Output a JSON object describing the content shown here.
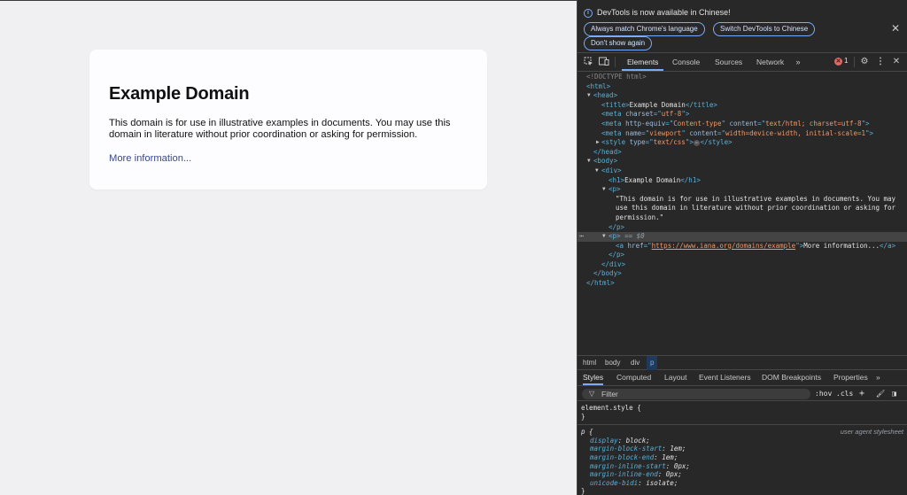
{
  "page": {
    "heading": "Example Domain",
    "body": "This domain is for use in illustrative examples in documents. You may use this domain in literature without prior coordination or asking for permission.",
    "link": "More information..."
  },
  "devtools": {
    "infobar": {
      "message": "DevTools is now available in Chinese!",
      "buttons": [
        "Always match Chrome's language",
        "Switch DevTools to Chinese",
        "Don't show again"
      ]
    },
    "tabs": [
      "Elements",
      "Console",
      "Sources",
      "Network"
    ],
    "active_tab": "Elements",
    "error_count": "1",
    "dom": {
      "doctype": "<!DOCTYPE html>",
      "title_text": "Example Domain",
      "meta1": {
        "name": "charset",
        "value": "utf-8"
      },
      "meta2": {
        "a1": "http-equiv",
        "v1": "Content-type",
        "a2": "content",
        "v2": "text/html; charset=utf-8"
      },
      "meta3": {
        "a1": "name",
        "v1": "viewport",
        "a2": "content",
        "v2": "width=device-width, initial-scale=1"
      },
      "style_attr": {
        "name": "type",
        "value": "text/css"
      },
      "h1_text": "Example Domain",
      "p_text_1": "\"This domain is for use in illustrative examples in documents. You may",
      "p_text_2": "use this domain in literature without prior coordination or asking for",
      "p_text_3": "permission.\"",
      "selected_marker": "== $0",
      "a_href": "https://www.iana.org/domains/example",
      "a_text": "More information..."
    },
    "breadcrumbs": [
      "html",
      "body",
      "div",
      "p"
    ],
    "subtabs": [
      "Styles",
      "Computed",
      "Layout",
      "Event Listeners",
      "DOM Breakpoints",
      "Properties"
    ],
    "filter": {
      "placeholder": "Filter",
      "hov": ":hov",
      "cls": ".cls"
    },
    "styles": {
      "element_style": "element.style {",
      "close_brace": "}",
      "p_selector": "p {",
      "source": "user agent stylesheet",
      "declarations": [
        {
          "prop": "display",
          "value": "block"
        },
        {
          "prop": "margin-block-start",
          "value": "1em"
        },
        {
          "prop": "margin-block-end",
          "value": "1em"
        },
        {
          "prop": "margin-inline-start",
          "value": "0px"
        },
        {
          "prop": "margin-inline-end",
          "value": "0px"
        },
        {
          "prop": "unicode-bidi",
          "value": "isolate"
        }
      ]
    }
  }
}
